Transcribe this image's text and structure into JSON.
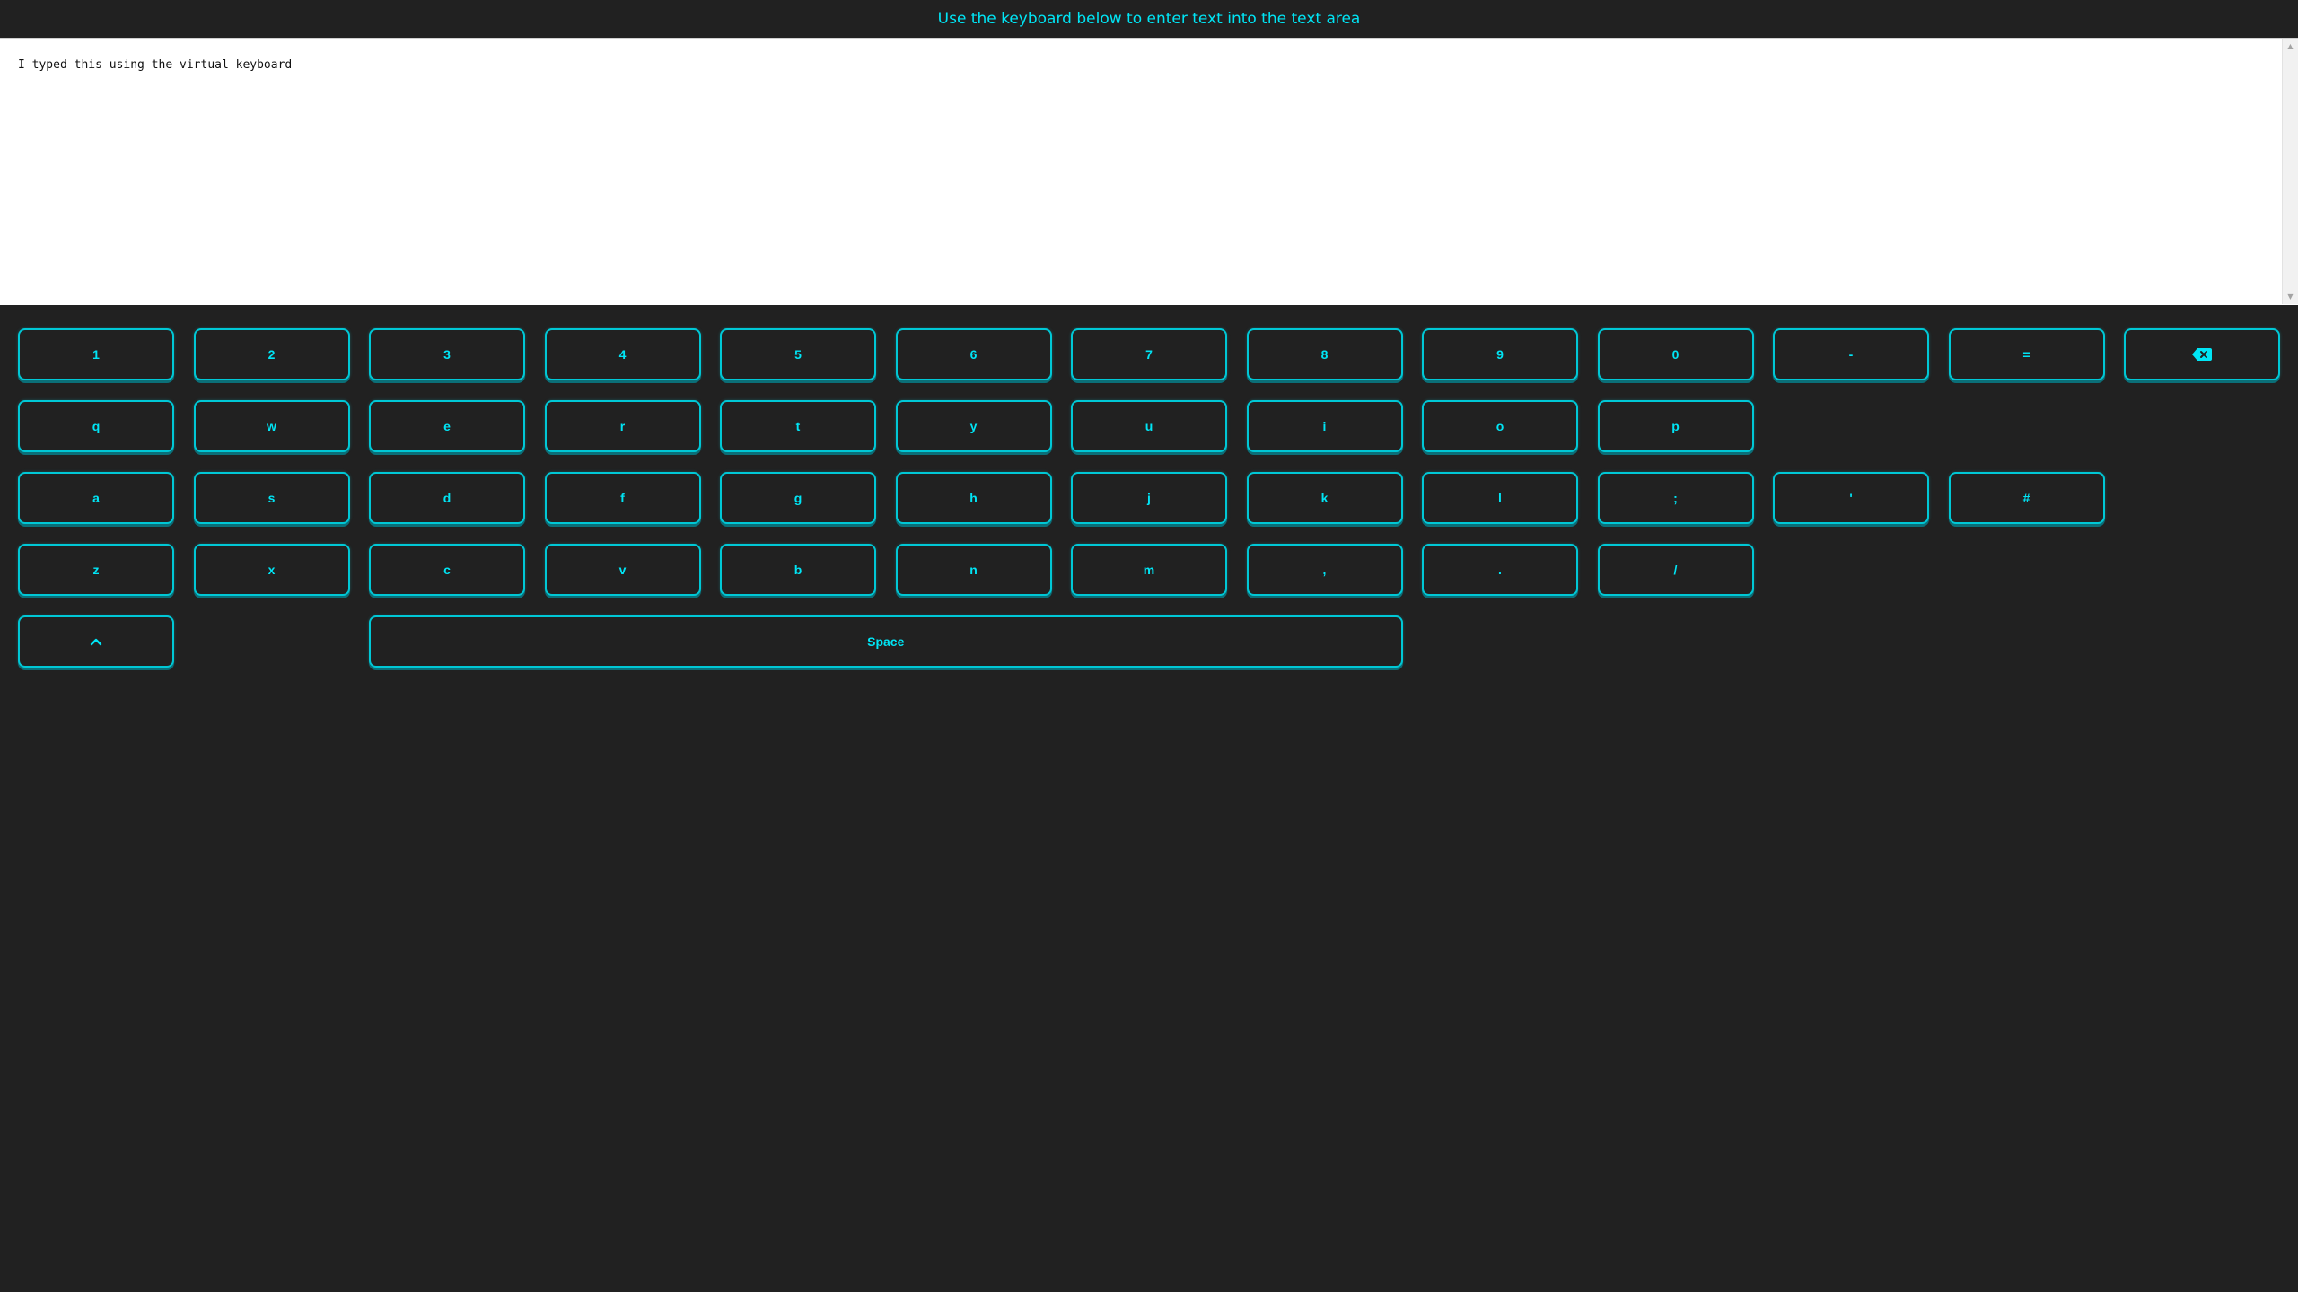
{
  "header": {
    "title": "Use the keyboard below to enter text into the text area"
  },
  "textarea": {
    "value": "I typed this using the virtual keyboard"
  },
  "scrollbar": {
    "up_icon": "triangle-up-icon",
    "down_icon": "triangle-down-icon"
  },
  "keyboard": {
    "accent_color": "#00e5f5",
    "border_color": "#00c8d6",
    "background": "#212121",
    "row1": [
      "1",
      "2",
      "3",
      "4",
      "5",
      "6",
      "7",
      "8",
      "9",
      "0",
      "-",
      "="
    ],
    "backspace_icon": "backspace-icon",
    "row2": [
      "q",
      "w",
      "e",
      "r",
      "t",
      "y",
      "u",
      "i",
      "o",
      "p"
    ],
    "row3": [
      "a",
      "s",
      "d",
      "f",
      "g",
      "h",
      "j",
      "k",
      "l",
      ";",
      "'",
      "#"
    ],
    "row4": [
      "z",
      "x",
      "c",
      "v",
      "b",
      "n",
      "m",
      ",",
      ".",
      "/"
    ],
    "shift_icon": "chevron-up-icon",
    "space_label": "Space"
  }
}
